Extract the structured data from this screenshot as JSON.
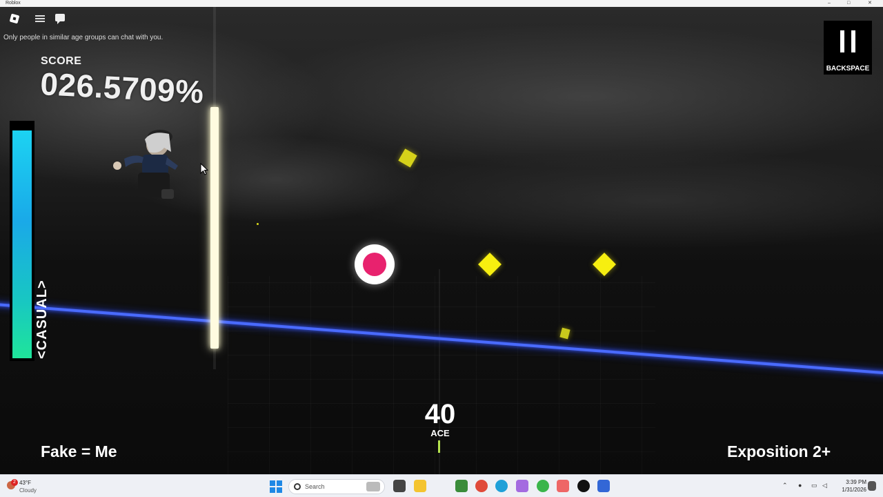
{
  "window": {
    "title": "Roblox",
    "controls": [
      "–",
      "□",
      "✕"
    ]
  },
  "top_bar": {
    "icons": [
      "roblox-logo-icon",
      "menu-icon",
      "chat-icon"
    ],
    "chat_notice": "Only people in similar age groups can chat with you."
  },
  "hud": {
    "score_label": "SCORE",
    "score_value": "026.5709%",
    "health_fraction": 0.97,
    "difficulty": "<CASUAL>",
    "pause_label": "BACKSPACE",
    "combo": "40",
    "rating": "ACE",
    "song_title": "Fake = Me",
    "song_difficulty": "Exposition 2+"
  },
  "colors": {
    "track": "#4a6bff",
    "note_pink": "#e8226e",
    "note_yellow": "#f7ef10",
    "health_top": "#1cd3f2",
    "health_bottom": "#1fe59a",
    "timing_tick": "#b5e34e"
  },
  "taskbar": {
    "weather_badge": "2",
    "weather_temp": "43°F",
    "weather_cond": "Cloudy",
    "search_placeholder": "Search",
    "app_icons": [
      "file-explorer-icon",
      "minecraft-icon",
      "chrome-icon",
      "edge-icon",
      "copilot-icon",
      "paint-icon",
      "snipping-tool-icon",
      "tiktok-icon",
      "roblox-icon"
    ],
    "tray_icons": [
      "chevron-up-icon",
      "microphone-icon",
      "wifi-icon",
      "volume-icon"
    ],
    "time": "3:39 PM",
    "date": "1/31/2026"
  }
}
